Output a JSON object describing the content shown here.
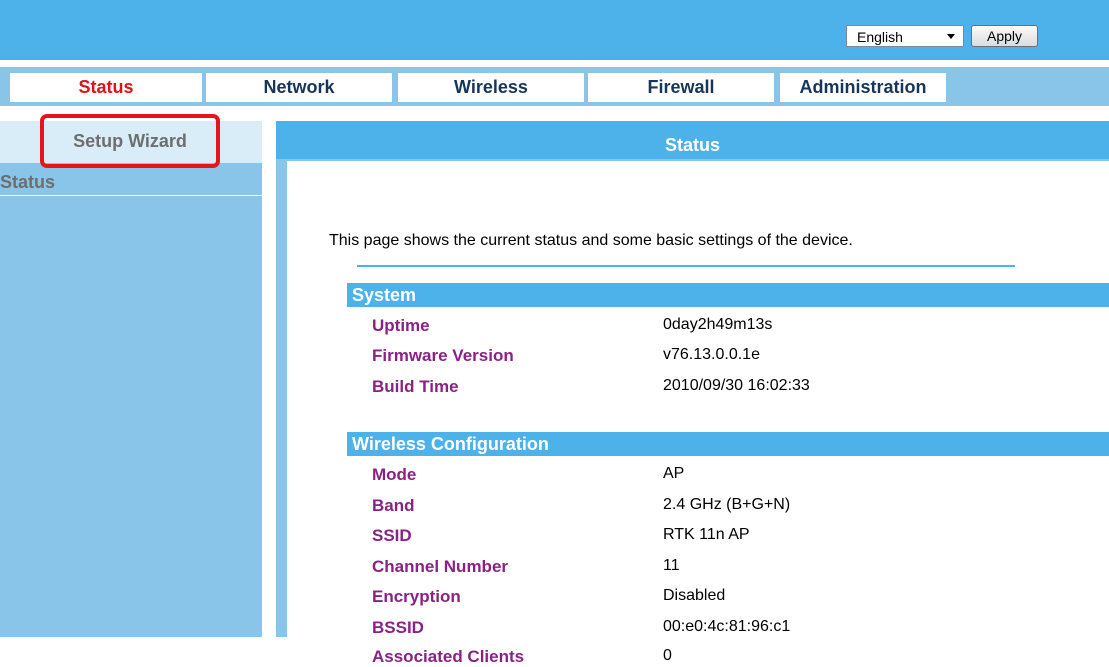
{
  "header": {
    "language_selected": "English",
    "apply_label": "Apply"
  },
  "nav": {
    "tabs": [
      {
        "label": "Status",
        "active": true
      },
      {
        "label": "Network",
        "active": false
      },
      {
        "label": "Wireless",
        "active": false
      },
      {
        "label": "Firewall",
        "active": false
      },
      {
        "label": "Administration",
        "active": false
      }
    ]
  },
  "sidebar": {
    "setup_wizard_label": "Setup Wizard",
    "status_label": "Status"
  },
  "main": {
    "title": "Status",
    "intro": "This page shows the current status and some basic settings of the device.",
    "sections": [
      {
        "title": "System",
        "fields": [
          {
            "label": "Uptime",
            "value": "0day2h49m13s"
          },
          {
            "label": "Firmware Version",
            "value": "v76.13.0.0.1e"
          },
          {
            "label": "Build Time",
            "value": "2010/09/30 16:02:33"
          }
        ]
      },
      {
        "title": "Wireless  Configuration",
        "fields": [
          {
            "label": "Mode",
            "value": "AP"
          },
          {
            "label": "Band",
            "value": "2.4 GHz (B+G+N)"
          },
          {
            "label": "SSID",
            "value": "RTK 11n AP"
          },
          {
            "label": "Channel Number",
            "value": "11"
          },
          {
            "label": "Encryption",
            "value": "Disabled"
          },
          {
            "label": "BSSID",
            "value": "00:e0:4c:81:96:c1"
          },
          {
            "label": "Associated Clients",
            "value": "0"
          }
        ]
      }
    ]
  },
  "colors": {
    "accent_blue": "#4db2ea",
    "light_blue": "#89c5e8",
    "active_tab_red": "#e0121a",
    "label_purple": "#8a2286",
    "highlight_red": "#e8141c"
  }
}
